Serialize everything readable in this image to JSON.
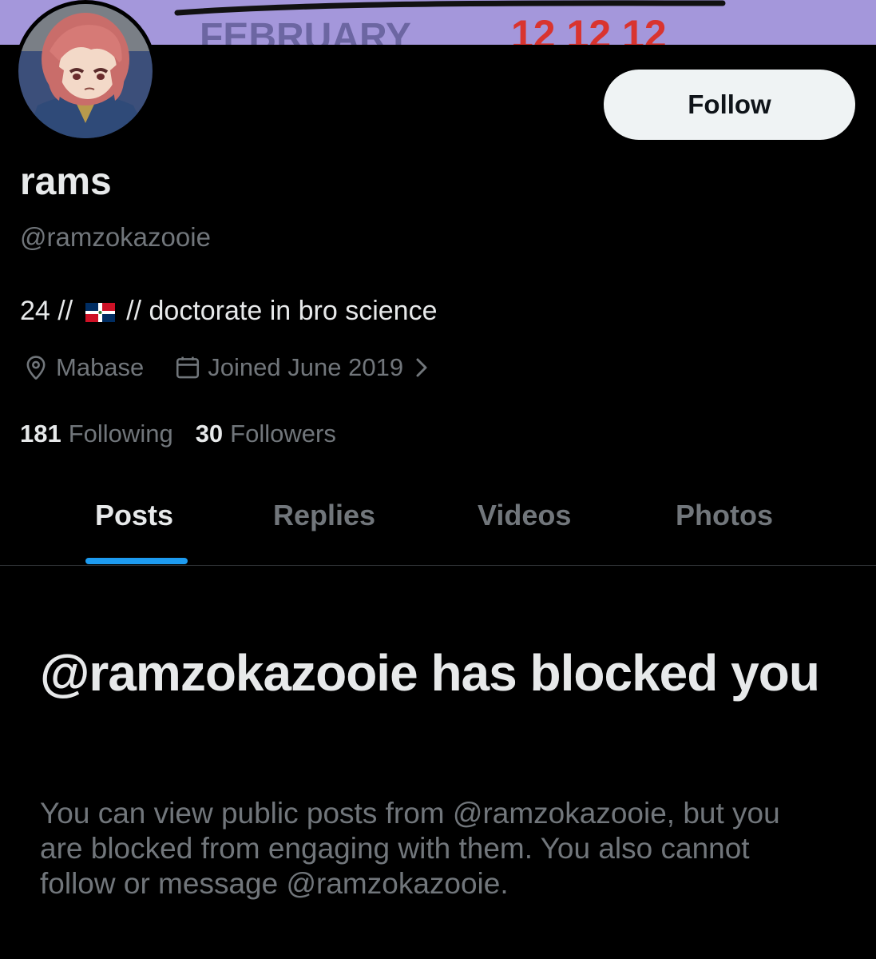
{
  "banner": {
    "text_fragment": "FEBRUARY 12 12 12"
  },
  "profile": {
    "display_name": "rams",
    "handle": "@ramzokazooie",
    "bio_prefix": "24 //",
    "bio_suffix": "// doctorate in bro science",
    "location": "Mabase",
    "joined": "Joined June 2019",
    "following_count": "181",
    "following_label": "Following",
    "followers_count": "30",
    "followers_label": "Followers"
  },
  "actions": {
    "follow_label": "Follow"
  },
  "tabs": [
    {
      "label": "Posts",
      "active": true
    },
    {
      "label": "Replies",
      "active": false
    },
    {
      "label": "Videos",
      "active": false
    },
    {
      "label": "Photos",
      "active": false
    }
  ],
  "blocked": {
    "title": "@ramzokazooie has blocked you",
    "body": "You can view public posts from @ramzokazooie, but you are blocked from engaging with them. You also cannot follow or message @ramzokazooie."
  },
  "colors": {
    "background": "#000000",
    "primary_text": "#e7e9ea",
    "secondary_text": "#71767b",
    "accent": "#1d9bf0",
    "follow_button_bg": "#eff3f4",
    "banner_bg": "#9d8fd6"
  },
  "icons": {
    "location": "location-pin-icon",
    "calendar": "calendar-icon",
    "chevron": "chevron-right-icon",
    "flag": "dominican-republic-flag-icon"
  }
}
